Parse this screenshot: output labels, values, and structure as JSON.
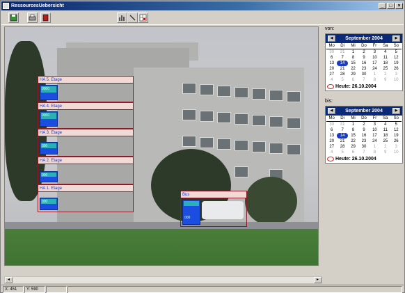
{
  "window": {
    "title": "RessourcesUebersicht",
    "controls": [
      "_",
      "□",
      "×"
    ]
  },
  "toolbar": {
    "left_icons": [
      "save-icon",
      "print-icon",
      "book-icon"
    ],
    "right_icons": [
      "chart-icon",
      "pen-icon",
      "table-icon"
    ]
  },
  "overlays": [
    {
      "label": "HA 5. Etage",
      "value": "0000"
    },
    {
      "label": "HA 4. Etage",
      "value": "0000"
    },
    {
      "label": "HA 3. Etage",
      "value": "000"
    },
    {
      "label": "HA 2. Etage",
      "value": "000"
    },
    {
      "label": "HA 1. Etage",
      "value": "000"
    },
    {
      "label": "Bus",
      "value": "000"
    }
  ],
  "status": {
    "x_readout": "X: 451",
    "y_readout": "Y: 590"
  },
  "calendar_from": {
    "label": "von:",
    "month": "September 2004",
    "weekdays": [
      "Mo",
      "Di",
      "Mi",
      "Do",
      "Fr",
      "Sa",
      "So"
    ],
    "days": [
      "30",
      "31",
      "1",
      "2",
      "3",
      "4",
      "5",
      "6",
      "7",
      "8",
      "9",
      "10",
      "11",
      "12",
      "13",
      "14",
      "15",
      "16",
      "17",
      "18",
      "19",
      "20",
      "21",
      "22",
      "23",
      "24",
      "25",
      "26",
      "27",
      "28",
      "29",
      "30",
      "1",
      "2",
      "3",
      "4",
      "5",
      "6",
      "7",
      "8",
      "9",
      "10"
    ],
    "muted": [
      0,
      1,
      32,
      33,
      34,
      35,
      36,
      37,
      38,
      39,
      40,
      41
    ],
    "selected": 15,
    "today": "Heute: 26.10.2004"
  },
  "calendar_to": {
    "label": "bis:",
    "month": "September 2004",
    "weekdays": [
      "Mo",
      "Di",
      "Mi",
      "Do",
      "Fr",
      "Sa",
      "So"
    ],
    "days": [
      "30",
      "31",
      "1",
      "2",
      "3",
      "4",
      "5",
      "6",
      "7",
      "8",
      "9",
      "10",
      "11",
      "12",
      "13",
      "14",
      "15",
      "16",
      "17",
      "18",
      "19",
      "20",
      "21",
      "22",
      "23",
      "24",
      "25",
      "26",
      "27",
      "28",
      "29",
      "30",
      "1",
      "2",
      "3",
      "4",
      "5",
      "6",
      "7",
      "8",
      "9",
      "10"
    ],
    "muted": [
      0,
      1,
      32,
      33,
      34,
      35,
      36,
      37,
      38,
      39,
      40,
      41
    ],
    "selected": 15,
    "today": "Heute: 26.10.2004"
  },
  "colors": {
    "titlebar": "#0a246a",
    "calendar_header": "#0b2a7a",
    "overlay_border": "#8c1c2a",
    "chip_blue": "#1b4de0",
    "chip_teal": "#2ab0b8"
  }
}
